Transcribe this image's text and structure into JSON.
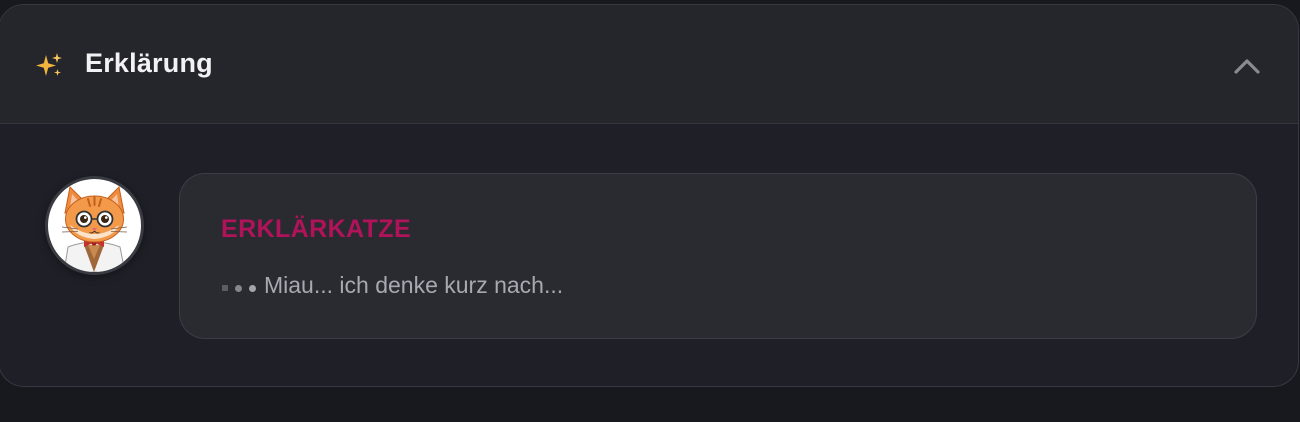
{
  "panel": {
    "title": "Erklärung",
    "icon": "sparkles-icon",
    "toggle_icon": "chevron-up-icon",
    "expanded": true
  },
  "message": {
    "avatar": "cat-scientist-avatar",
    "speaker": "ERKLÄRKATZE",
    "status_text": "Miau... ich denke kurz nach...",
    "status_indicator": "typing-dots"
  },
  "colors": {
    "page_background": "#18181f",
    "panel_background": "#1f1f27",
    "header_background": "#25252c",
    "bubble_background": "#2a2a31",
    "speaker_accent": "#b0135a",
    "title_text": "#f2f2f4",
    "muted_text": "#a8a8b0",
    "sparkles": "#f2b43c"
  }
}
